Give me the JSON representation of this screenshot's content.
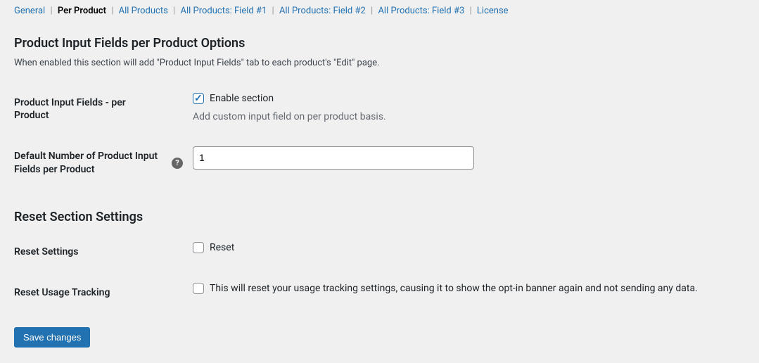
{
  "tabs": {
    "general": "General",
    "per_product": "Per Product",
    "all_products": "All Products",
    "field1": "All Products: Field #1",
    "field2": "All Products: Field #2",
    "field3": "All Products: Field #3",
    "license": "License"
  },
  "section": {
    "heading": "Product Input Fields per Product Options",
    "description": "When enabled this section will add \"Product Input Fields\" tab to each product's \"Edit\" page."
  },
  "fields": {
    "enable": {
      "label": "Product Input Fields - per Product",
      "checkbox_label": "Enable section",
      "description": "Add custom input field on per product basis.",
      "checked": true
    },
    "default_number": {
      "label": "Default Number of Product Input Fields per Product",
      "value": "1",
      "help": "?"
    }
  },
  "reset_section": {
    "heading": "Reset Section Settings",
    "settings": {
      "label": "Reset Settings",
      "checkbox_label": "Reset",
      "checked": false
    },
    "usage": {
      "label": "Reset Usage Tracking",
      "checkbox_label": "This will reset your usage tracking settings, causing it to show the opt-in banner again and not sending any data.",
      "checked": false
    }
  },
  "submit": {
    "label": "Save changes"
  }
}
